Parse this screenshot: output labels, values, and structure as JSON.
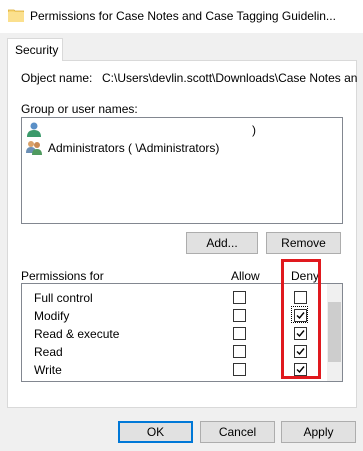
{
  "window": {
    "title": "Permissions for Case Notes and Case Tagging Guidelin..."
  },
  "tabs": [
    {
      "label": "Security"
    }
  ],
  "object": {
    "label": "Object name:",
    "value": "C:\\Users\\devlin.scott\\Downloads\\Case Notes and"
  },
  "group": {
    "label": "Group or user names:",
    "users": [
      {
        "name": ")",
        "icon": "user-icon"
      },
      {
        "name": "Administrators (                           \\Administrators)",
        "icon": "group-icon"
      }
    ]
  },
  "buttons": {
    "add": "Add...",
    "remove": "Remove",
    "ok": "OK",
    "cancel": "Cancel",
    "apply": "Apply"
  },
  "permissions": {
    "header_for": "Permissions for",
    "header_allow": "Allow",
    "header_deny": "Deny",
    "rows": [
      {
        "name": "Full control",
        "allow": false,
        "deny": false
      },
      {
        "name": "Modify",
        "allow": false,
        "deny": true
      },
      {
        "name": "Read & execute",
        "allow": false,
        "deny": true
      },
      {
        "name": "Read",
        "allow": false,
        "deny": true
      },
      {
        "name": "Write",
        "allow": false,
        "deny": true
      }
    ]
  },
  "colors": {
    "highlight": "#e0191e",
    "accent": "#0078d7"
  }
}
